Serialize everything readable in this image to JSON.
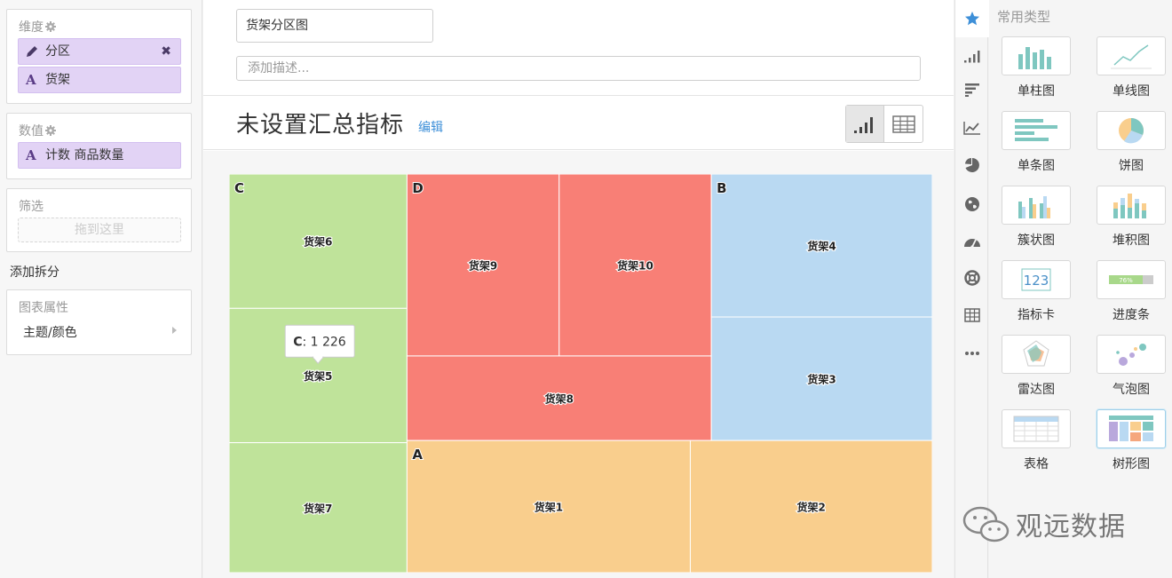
{
  "left": {
    "dimensions": {
      "title": "维度",
      "items": [
        {
          "icon": "pencil-icon",
          "label": "分区",
          "removable": true
        },
        {
          "icon": "text-type-icon",
          "glyph": "A",
          "label": "货架",
          "removable": false
        }
      ]
    },
    "values": {
      "title": "数值",
      "items": [
        {
          "icon": "text-type-icon",
          "glyph": "A",
          "label": "计数 商品数量"
        }
      ]
    },
    "filter": {
      "title": "筛选",
      "placeholder": "拖到这里"
    },
    "add_split": "添加拆分",
    "properties": {
      "title": "图表属性",
      "item": "主题/颜色"
    }
  },
  "center": {
    "chart_title": "货架分区图",
    "description_placeholder": "添加描述...",
    "summary_title": "未设置汇总指标",
    "edit_link": "编辑",
    "view_toggle": [
      "chart-view",
      "table-view"
    ],
    "selected_view": "chart-view"
  },
  "chart_data": {
    "type": "treemap",
    "groups": [
      {
        "name": "C",
        "color": "#bfe39a",
        "children": [
          {
            "name": "货架6",
            "value": 1226
          },
          {
            "name": "货架5",
            "value": 1226
          },
          {
            "name": "货架7",
            "value": 1186
          }
        ]
      },
      {
        "name": "D",
        "color": "#f87f76",
        "children": [
          {
            "name": "货架9",
            "value": 1420
          },
          {
            "name": "货架10",
            "value": 1420
          },
          {
            "name": "货架8",
            "value": 1320
          }
        ]
      },
      {
        "name": "B",
        "color": "#b9d9f2",
        "children": [
          {
            "name": "货架4",
            "value": 1620
          },
          {
            "name": "货架3",
            "value": 1400
          }
        ]
      },
      {
        "name": "A",
        "color": "#f9ce8d",
        "children": [
          {
            "name": "货架1",
            "value": 1920
          },
          {
            "name": "货架2",
            "value": 1640
          }
        ]
      }
    ],
    "tooltip": {
      "label": "C",
      "value": "1 226"
    }
  },
  "rail": {
    "icons": [
      "star-icon",
      "bar-chart-icon",
      "horizontal-bar-icon",
      "line-chart-icon",
      "pie-chart-icon",
      "globe-icon",
      "gauge-icon",
      "lifebuoy-icon",
      "table-icon",
      "more-icon"
    ],
    "active": "star-icon"
  },
  "right": {
    "title": "常用类型",
    "types": [
      {
        "label": "单柱图",
        "icon": "single-bar-chart-icon"
      },
      {
        "label": "单线图",
        "icon": "single-line-chart-icon"
      },
      {
        "label": "单条图",
        "icon": "single-horizontal-bar-icon"
      },
      {
        "label": "饼图",
        "icon": "pie-chart-icon"
      },
      {
        "label": "簇状图",
        "icon": "clustered-bar-icon"
      },
      {
        "label": "堆积图",
        "icon": "stacked-bar-icon"
      },
      {
        "label": "指标卡",
        "icon": "metric-card-icon",
        "text": "123"
      },
      {
        "label": "进度条",
        "icon": "progress-bar-icon",
        "text": "76%"
      },
      {
        "label": "雷达图",
        "icon": "radar-chart-icon"
      },
      {
        "label": "气泡图",
        "icon": "bubble-chart-icon"
      },
      {
        "label": "表格",
        "icon": "table-chart-icon"
      },
      {
        "label": "树形图",
        "icon": "treemap-chart-icon",
        "selected": true
      }
    ]
  },
  "watermark": "观远数据",
  "colors": {
    "pill": "#e2d3f5",
    "accent": "#3d8fd8",
    "rail_active": "#3d8fd8"
  }
}
